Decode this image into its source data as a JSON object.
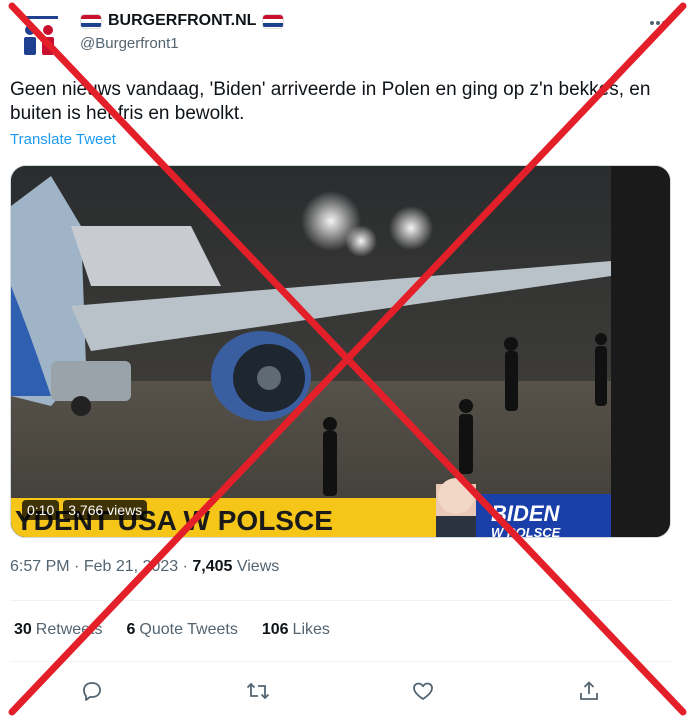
{
  "tweet": {
    "display_name": "BURGERFRONT.NL",
    "username": "@Burgerfront1",
    "more_icon": "more-horizontal-icon",
    "text": "Geen nieuws vandaag, 'Biden' arriveerde in Polen en ging op z'n bekkes, en buiten is het fris en bewolkt.",
    "translate_label": "Translate Tweet",
    "media": {
      "duration": "0:10",
      "views": "3,766 views",
      "ticker_text": "YDENT USA W POLSCE",
      "ticker_sub": "...",
      "logo_line1": "BIDEN",
      "logo_line2": "W POLSCE"
    },
    "time": "6:57 PM",
    "separator": "·",
    "date": "Feb 21, 2023",
    "view_count": "7,405",
    "view_label": "Views",
    "stats": [
      {
        "num": "30",
        "label": "Retweets"
      },
      {
        "num": "6",
        "label": "Quote Tweets"
      },
      {
        "num": "106",
        "label": "Likes"
      }
    ],
    "actions": [
      "reply-icon",
      "retweet-icon",
      "like-icon",
      "share-icon"
    ]
  },
  "overlay": {
    "type": "red-x-cross",
    "color": "#e3202a"
  },
  "colors": {
    "accent": "#1d9bf0",
    "secondary_text": "#536471",
    "primary_text": "#0f1419",
    "ticker_yellow": "#f5c518",
    "flag_red": "#c8102e",
    "flag_blue": "#1f3f8f"
  }
}
